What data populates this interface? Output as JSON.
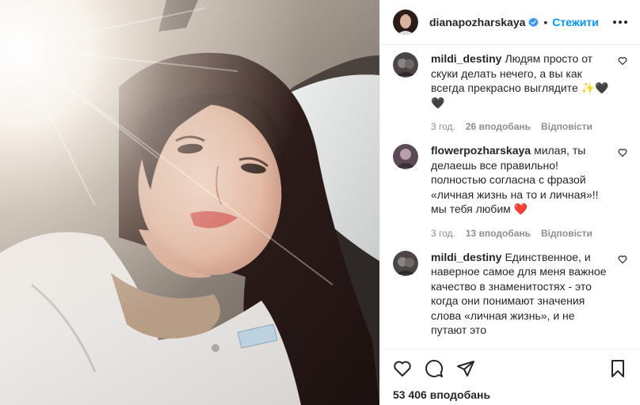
{
  "header": {
    "username": "dianapozharskaya",
    "separator": "•",
    "follow_label": "Стежити"
  },
  "comments": [
    {
      "username": "mildi_destiny",
      "text": "Людям просто от скуки делать нечего, а вы как всегда прекрасно выглядите ✨🖤🖤",
      "time": "3 год.",
      "likes": "26 вподобань",
      "reply": "Відповісти"
    },
    {
      "username": "flowerpozharskaya",
      "text": "милая, ты делаешь все правильно! полностью согласна с фразой «личная жизнь на то и личная»!! мы тебя любим ❤️",
      "time": "3 год.",
      "likes": "13 вподобань",
      "reply": "Відповісти"
    },
    {
      "username": "mildi_destiny",
      "text": "Единственное, и наверное самое для меня важное качество в знаменитостях - это когда они понимают значения слова «личная жизнь», и не путают это",
      "time": "",
      "likes": "",
      "reply": ""
    }
  ],
  "footer": {
    "likes_count": "53 406 вподобань"
  },
  "colors": {
    "link_blue": "#0095f6",
    "text": "#262626",
    "muted": "#8e8e8e",
    "border": "#efefef",
    "verified": "#3897f0"
  },
  "icons": [
    "heart-icon",
    "comment-icon",
    "share-icon",
    "bookmark-icon",
    "more-options-icon",
    "verified-icon",
    "small-heart-icon"
  ]
}
